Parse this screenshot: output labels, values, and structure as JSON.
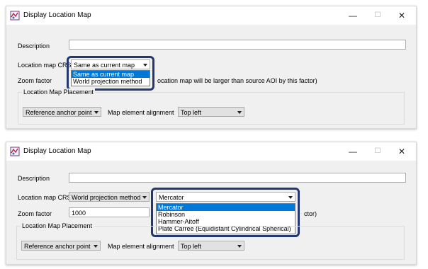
{
  "dialog1": {
    "title": "Display Location Map",
    "description_label": "Description",
    "crs_label": "Location map CRS",
    "crs_value": "Same as current map",
    "crs_options": [
      "Same as current map",
      "World projection method"
    ],
    "zoom_label": "Zoom factor",
    "zoom_hint_partial": "ocation map will be larger than source AOI by this factor)",
    "placement_group": "Location Map Placement",
    "anchor_value": "Reference anchor point",
    "alignment_label": "Map element alignment",
    "alignment_value": "Top left"
  },
  "dialog2": {
    "title": "Display Location Map",
    "description_label": "Description",
    "crs_label": "Location map CRS",
    "crs_value": "World projection method",
    "projection_value": "Mercator",
    "projection_options": [
      "Mercator",
      "Robinson",
      "Hammer-Aitoff",
      "Plate Carree (Equidistant Cylindrical Spherical)"
    ],
    "zoom_label": "Zoom factor",
    "zoom_value": "1000",
    "zoom_hint_partial": "ctor)",
    "placement_group": "Location Map Placement",
    "anchor_value": "Reference anchor point",
    "alignment_label": "Map element alignment",
    "alignment_value": "Top left"
  },
  "window_controls": {
    "minimize": "—",
    "maximize": "☐",
    "close": "✕"
  },
  "colors": {
    "highlight_border": "#24386f",
    "selection": "#0078d7"
  }
}
